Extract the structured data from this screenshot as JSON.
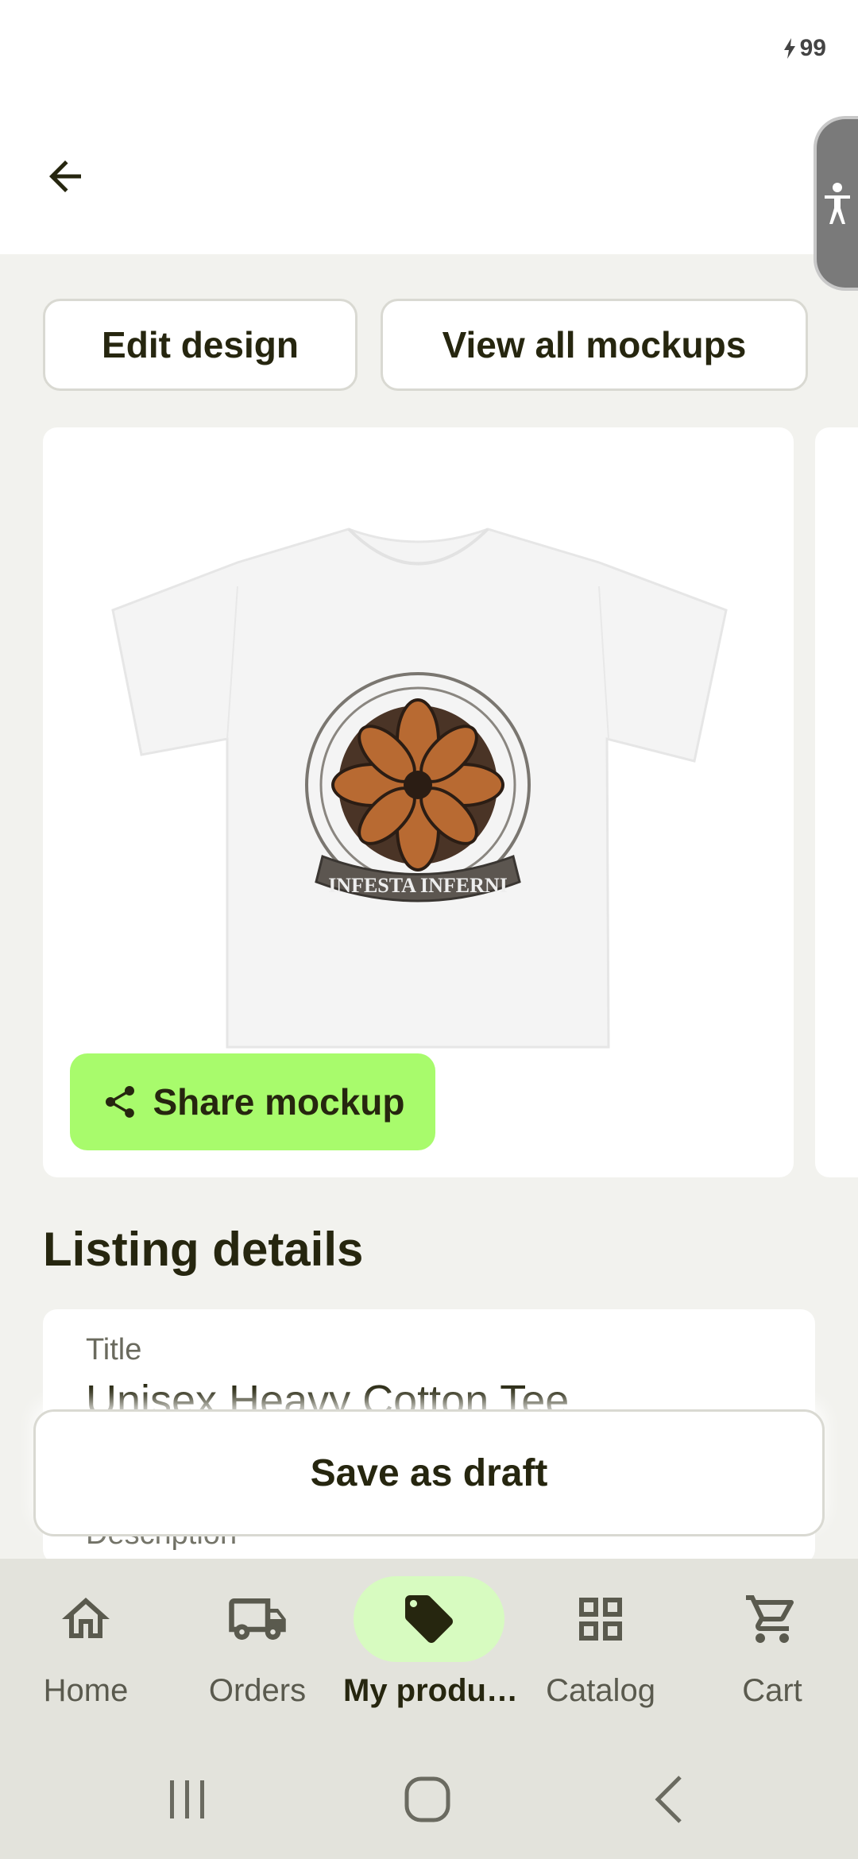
{
  "status_bar": {
    "battery_level": "99",
    "icon": "charging-bolt-icon"
  },
  "app_bar": {
    "back_icon": "arrow-left-icon",
    "accessibility_icon": "accessibility-icon"
  },
  "actions": {
    "edit_design": "Edit design",
    "view_all_mockups": "View all mockups"
  },
  "mockup": {
    "image": "white-tshirt-mockup",
    "print_text": "INFESTA INFERNI",
    "share_label": "Share mockup",
    "share_icon": "share-icon",
    "accent": "#a8fb6c"
  },
  "listing": {
    "section_title": "Listing details",
    "title_label": "Title",
    "title_value": "Unisex Heavy Cotton Tee",
    "description_label": "Description"
  },
  "save_draft": "Save as draft",
  "nav": {
    "items": [
      {
        "label": "Home",
        "icon": "home-icon"
      },
      {
        "label": "Orders",
        "icon": "truck-icon"
      },
      {
        "label": "My produ…",
        "icon": "tag-icon",
        "active": true
      },
      {
        "label": "Catalog",
        "icon": "grid-icon"
      },
      {
        "label": "Cart",
        "icon": "cart-icon"
      }
    ]
  },
  "system_nav": {
    "recents": "recents-icon",
    "home": "home-circle-icon",
    "back": "back-chevron-icon"
  }
}
